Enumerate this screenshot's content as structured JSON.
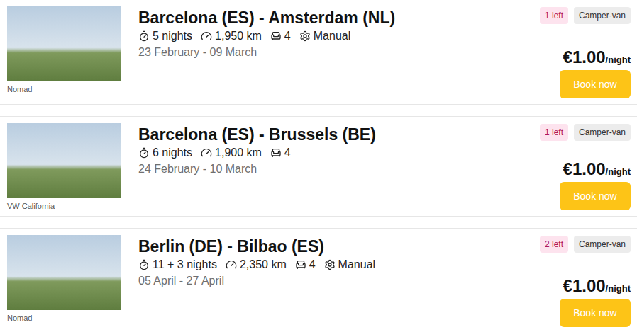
{
  "listings": [
    {
      "photo_caption": "Nomad",
      "title": "Barcelona (ES) - Amsterdam (NL)",
      "nights": "5 nights",
      "distance": "1,950 km",
      "seats": "4",
      "transmission": "Manual",
      "dates": "23 February - 09 March",
      "remaining": "1 left",
      "type": "Camper-van",
      "price": "€1.00",
      "price_unit": "/night",
      "button": "Book now"
    },
    {
      "photo_caption": "VW California",
      "title": "Barcelona (ES) - Brussels (BE)",
      "nights": "6 nights",
      "distance": "1,900 km",
      "seats": "4",
      "dates": "24 February - 10 March",
      "remaining": "1 left",
      "type": "Camper-van",
      "price": "€1.00",
      "price_unit": "/night",
      "button": "Book now"
    },
    {
      "photo_caption": "Nomad",
      "title": "Berlin (DE) - Bilbao (ES)",
      "nights": "11 + 3 nights",
      "distance": "2,350 km",
      "seats": "4",
      "transmission": "Manual",
      "dates": "05 April - 27 April",
      "remaining": "2 left",
      "type": "Camper-van",
      "price": "€1.00",
      "price_unit": "/night",
      "button": "Book now"
    }
  ]
}
